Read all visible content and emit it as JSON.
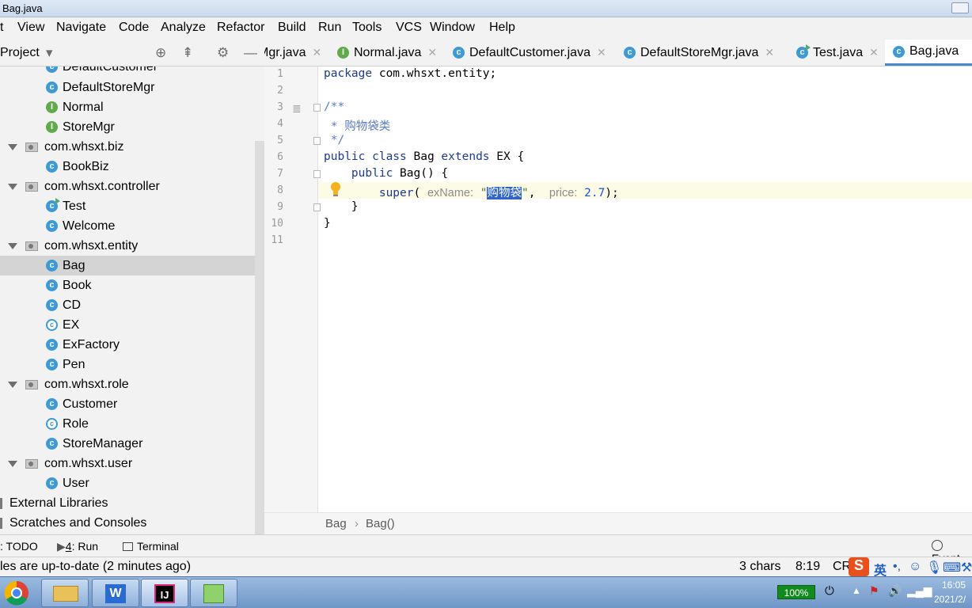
{
  "window": {
    "title": "Bag.java"
  },
  "menu": [
    "t",
    "View",
    "Navigate",
    "Code",
    "Analyze",
    "Refactor",
    "Build",
    "Run",
    "Tools",
    "VCS",
    "Window",
    "Help"
  ],
  "toolbar": {
    "project_label": "Project",
    "icons": [
      "dropdown-icon",
      "locate-icon",
      "collapse-icon",
      "gear-icon",
      "minimize-icon"
    ]
  },
  "tabs": [
    {
      "label": "Mgr.java",
      "icon": "class-icon"
    },
    {
      "label": "Normal.java",
      "icon": "interface-icon"
    },
    {
      "label": "DefaultCustomer.java",
      "icon": "class-icon"
    },
    {
      "label": "DefaultStoreMgr.java",
      "icon": "class-icon"
    },
    {
      "label": "Test.java",
      "icon": "runnable-class-icon"
    },
    {
      "label": "Bag.java",
      "icon": "class-icon",
      "active": true
    }
  ],
  "tree": [
    {
      "label": "DefaultCustomer",
      "kind": "class"
    },
    {
      "label": "DefaultStoreMgr",
      "kind": "class"
    },
    {
      "label": "Normal",
      "kind": "interface"
    },
    {
      "label": "StoreMgr",
      "kind": "interface"
    },
    {
      "label": "com.whsxt.biz",
      "kind": "package"
    },
    {
      "label": "BookBiz",
      "kind": "class"
    },
    {
      "label": "com.whsxt.controller",
      "kind": "package"
    },
    {
      "label": "Test",
      "kind": "runnable"
    },
    {
      "label": "Welcome",
      "kind": "class"
    },
    {
      "label": "com.whsxt.entity",
      "kind": "package"
    },
    {
      "label": "Bag",
      "kind": "class",
      "selected": true
    },
    {
      "label": "Book",
      "kind": "class"
    },
    {
      "label": "CD",
      "kind": "class"
    },
    {
      "label": "EX",
      "kind": "abstract"
    },
    {
      "label": "ExFactory",
      "kind": "class"
    },
    {
      "label": "Pen",
      "kind": "class"
    },
    {
      "label": "com.whsxt.role",
      "kind": "package"
    },
    {
      "label": "Customer",
      "kind": "class"
    },
    {
      "label": "Role",
      "kind": "abstract"
    },
    {
      "label": "StoreManager",
      "kind": "class"
    },
    {
      "label": "com.whsxt.user",
      "kind": "package"
    },
    {
      "label": "User",
      "kind": "class"
    },
    {
      "label": "External Libraries",
      "kind": "libraries"
    },
    {
      "label": "Scratches and Consoles",
      "kind": "scratches"
    }
  ],
  "editor": {
    "line_numbers": [
      "1",
      "2",
      "3",
      "4",
      "5",
      "6",
      "7",
      "8",
      "9",
      "10",
      "11"
    ],
    "l1": {
      "kw": "package",
      "rest": " com.whsxt.entity;"
    },
    "l3": "/**",
    "l4": " * 购物袋类",
    "l5": " */",
    "l6": {
      "kw1": "public class",
      "name": " Bag ",
      "kw2": "extends",
      "rest": " EX {"
    },
    "l7": {
      "indent": "    ",
      "kw": "public",
      "rest": " Bag() {"
    },
    "l8": {
      "indent": "        ",
      "kw": "super",
      "open": "(",
      "hint1": "exName:",
      "q1": "\"",
      "selected": "购物袋",
      "q2": "\"",
      "comma": ",",
      "hint2": "price:",
      "num": "2.7",
      "close": ");"
    },
    "l9": "    }",
    "l10": "}"
  },
  "breadcrumb": [
    "Bag",
    "Bag()"
  ],
  "toolwindows": {
    "todo": ": TODO",
    "run_num": "4",
    "run_label": ": Run",
    "terminal": "Terminal",
    "event": "Event"
  },
  "status": {
    "message": "les are up-to-date (2 minutes ago)",
    "chars": "3 chars",
    "position": "8:19",
    "line_sep": "CR"
  },
  "taskbar": {
    "battery": "100%",
    "ime": "英",
    "time": "16:05",
    "date": "2021/2/"
  }
}
